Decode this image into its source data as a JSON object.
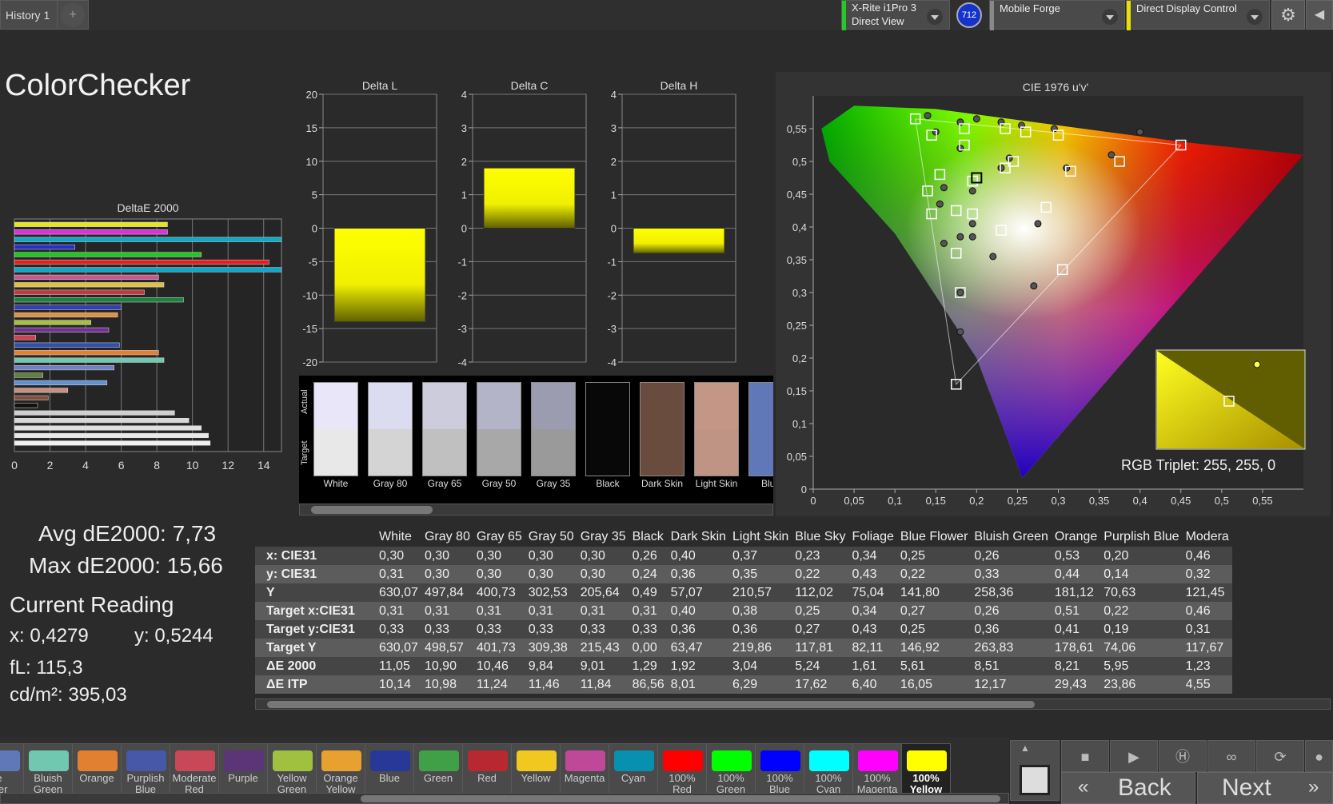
{
  "topbar": {
    "tab_label": "History 1",
    "tab_add": "+",
    "meter_line1": "X-Rite i1Pro 3",
    "meter_line2": "Direct View",
    "meter_color": "#22cc22",
    "badge": "712",
    "badge_color": "#1533c8",
    "pattern_source": "Mobile Forge",
    "pattern_color": "#888888",
    "display_control": "Direct Display Control",
    "display_color": "#e8e000",
    "settings_icon": "gear-icon"
  },
  "page_title": "ColorChecker",
  "deltae_chart": {
    "title": "DeltaE 2000",
    "ticks": [
      "0",
      "2",
      "4",
      "6",
      "8",
      "10",
      "12",
      "14"
    ],
    "xlim": [
      0,
      15
    ],
    "bars": [
      {
        "color": "#e5e520",
        "value": 8.6
      },
      {
        "color": "#dd30dd",
        "value": 8.6
      },
      {
        "color": "#10a8c8",
        "value": 15.0
      },
      {
        "color": "#2030c8",
        "value": 3.4
      },
      {
        "color": "#20c820",
        "value": 10.5
      },
      {
        "color": "#e02020",
        "value": 14.3
      },
      {
        "color": "#10a8c8",
        "value": 15.0
      },
      {
        "color": "#c85890",
        "value": 8.1
      },
      {
        "color": "#e0c040",
        "value": 8.4
      },
      {
        "color": "#c03840",
        "value": 7.3
      },
      {
        "color": "#208040",
        "value": 9.5
      },
      {
        "color": "#3040b0",
        "value": 6.0
      },
      {
        "color": "#e09040",
        "value": 5.8
      },
      {
        "color": "#a8c040",
        "value": 4.3
      },
      {
        "color": "#703090",
        "value": 5.3
      },
      {
        "color": "#d04050",
        "value": 1.2
      },
      {
        "color": "#3050b0",
        "value": 5.9
      },
      {
        "color": "#e08030",
        "value": 8.1
      },
      {
        "color": "#70c8b0",
        "value": 8.4
      },
      {
        "color": "#7080c0",
        "value": 5.6
      },
      {
        "color": "#608040",
        "value": 1.6
      },
      {
        "color": "#6090d0",
        "value": 5.2
      },
      {
        "color": "#c89080",
        "value": 3.0
      },
      {
        "color": "#805040",
        "value": 1.9
      },
      {
        "color": "#101010",
        "value": 1.3
      },
      {
        "color": "#d0d0d0",
        "value": 9.0
      },
      {
        "color": "#d8d8d8",
        "value": 9.8
      },
      {
        "color": "#e0e0e0",
        "value": 10.5
      },
      {
        "color": "#e8e8e8",
        "value": 10.9
      },
      {
        "color": "#f0f0f0",
        "value": 11.0
      }
    ]
  },
  "stats": {
    "avg": "Avg dE2000: 7,73",
    "max": "Max dE2000: 15,66",
    "current_reading": "Current Reading",
    "x": "x: 0,4279",
    "y": "y: 0,5244",
    "fl": "fL: 115,3",
    "cdm2": "cd/m²: 395,03"
  },
  "delta_charts": [
    {
      "title": "Delta L",
      "ticks": [
        "20",
        "15",
        "10",
        "5",
        "0",
        "-5",
        "-10",
        "-15",
        "-20"
      ],
      "ylim": [
        -20,
        20
      ],
      "value": -14
    },
    {
      "title": "Delta C",
      "ticks": [
        "4",
        "3",
        "2",
        "1",
        "0",
        "-1",
        "-2",
        "-3",
        "-4"
      ],
      "ylim": [
        -4,
        4
      ],
      "value": 1.8
    },
    {
      "title": "Delta H",
      "ticks": [
        "4",
        "3",
        "2",
        "1",
        "0",
        "-1",
        "-2",
        "-3",
        "-4"
      ],
      "ylim": [
        -4,
        4
      ],
      "value": -0.75
    }
  ],
  "swatches": {
    "actual_label": "Actual",
    "target_label": "Target",
    "items": [
      {
        "label": "White",
        "actual": "#e8e6f8",
        "target": "#e8e8e8"
      },
      {
        "label": "Gray 80",
        "actual": "#dcdcf0",
        "target": "#d4d4d4"
      },
      {
        "label": "Gray 65",
        "actual": "#ccccdc",
        "target": "#c0c0c0"
      },
      {
        "label": "Gray 50",
        "actual": "#b4b4c8",
        "target": "#a8a8a8"
      },
      {
        "label": "Gray 35",
        "actual": "#9c9cb0",
        "target": "#9a9a9a"
      },
      {
        "label": "Black",
        "actual": "#080808",
        "target": "#080808"
      },
      {
        "label": "Dark Skin",
        "actual": "#6a4c3e",
        "target": "#6a4c3e"
      },
      {
        "label": "Light Skin",
        "actual": "#c49686",
        "target": "#c09484"
      },
      {
        "label": "Blue",
        "actual": "#6078b8",
        "target": "#6078b8"
      }
    ]
  },
  "cie": {
    "title": "CIE 1976 u'v'",
    "x_ticks": [
      "0",
      "0,05",
      "0,1",
      "0,15",
      "0,2",
      "0,25",
      "0,3",
      "0,35",
      "0,4",
      "0,45",
      "0,5",
      "0,55"
    ],
    "y_ticks": [
      "0",
      "0,05",
      "0,1",
      "0,15",
      "0,2",
      "0,25",
      "0,3",
      "0,35",
      "0,4",
      "0,45",
      "0,5",
      "0,55"
    ],
    "xlim": [
      0,
      0.6
    ],
    "ylim": [
      0,
      0.6
    ],
    "targets": [
      [
        0.125,
        0.565
      ],
      [
        0.145,
        0.54
      ],
      [
        0.185,
        0.55
      ],
      [
        0.235,
        0.55
      ],
      [
        0.26,
        0.545
      ],
      [
        0.3,
        0.54
      ],
      [
        0.375,
        0.5
      ],
      [
        0.45,
        0.525
      ],
      [
        0.315,
        0.485
      ],
      [
        0.2,
        0.475
      ],
      [
        0.245,
        0.5
      ],
      [
        0.235,
        0.49
      ],
      [
        0.155,
        0.48
      ],
      [
        0.14,
        0.455
      ],
      [
        0.195,
        0.47
      ],
      [
        0.175,
        0.425
      ],
      [
        0.195,
        0.42
      ],
      [
        0.145,
        0.42
      ],
      [
        0.23,
        0.395
      ],
      [
        0.285,
        0.43
      ],
      [
        0.175,
        0.36
      ],
      [
        0.305,
        0.335
      ],
      [
        0.18,
        0.3
      ],
      [
        0.175,
        0.16
      ],
      [
        0.185,
        0.525
      ]
    ],
    "measured": [
      [
        0.14,
        0.57
      ],
      [
        0.15,
        0.545
      ],
      [
        0.18,
        0.56
      ],
      [
        0.2,
        0.565
      ],
      [
        0.23,
        0.56
      ],
      [
        0.255,
        0.555
      ],
      [
        0.295,
        0.55
      ],
      [
        0.4,
        0.545
      ],
      [
        0.365,
        0.51
      ],
      [
        0.24,
        0.505
      ],
      [
        0.23,
        0.49
      ],
      [
        0.31,
        0.49
      ],
      [
        0.18,
        0.52
      ],
      [
        0.16,
        0.46
      ],
      [
        0.155,
        0.435
      ],
      [
        0.195,
        0.455
      ],
      [
        0.195,
        0.405
      ],
      [
        0.18,
        0.385
      ],
      [
        0.195,
        0.385
      ],
      [
        0.16,
        0.375
      ],
      [
        0.22,
        0.355
      ],
      [
        0.275,
        0.405
      ],
      [
        0.18,
        0.3
      ],
      [
        0.18,
        0.24
      ],
      [
        0.27,
        0.31
      ]
    ],
    "current": [
      0.2,
      0.475
    ],
    "rgb_triplet": "RGB Triplet: 255, 255, 0"
  },
  "table": {
    "columns": [
      "White",
      "Gray 80",
      "Gray 65",
      "Gray 50",
      "Gray 35",
      "Black",
      "Dark Skin",
      "Light Skin",
      "Blue Sky",
      "Foliage",
      "Blue Flower",
      "Bluish Green",
      "Orange",
      "Purplish Blue",
      "Modera"
    ],
    "rows": [
      {
        "label": "x: CIE31",
        "values": [
          "0,30",
          "0,30",
          "0,30",
          "0,30",
          "0,30",
          "0,26",
          "0,40",
          "0,37",
          "0,23",
          "0,34",
          "0,25",
          "0,26",
          "0,53",
          "0,20",
          "0,46"
        ]
      },
      {
        "label": "y: CIE31",
        "values": [
          "0,31",
          "0,30",
          "0,30",
          "0,30",
          "0,30",
          "0,24",
          "0,36",
          "0,35",
          "0,22",
          "0,43",
          "0,22",
          "0,33",
          "0,44",
          "0,14",
          "0,32"
        ]
      },
      {
        "label": "Y",
        "values": [
          "630,07",
          "497,84",
          "400,73",
          "302,53",
          "205,64",
          "0,49",
          "57,07",
          "210,57",
          "112,02",
          "75,04",
          "141,80",
          "258,36",
          "181,12",
          "70,63",
          "121,45"
        ]
      },
      {
        "label": "Target x:CIE31",
        "values": [
          "0,31",
          "0,31",
          "0,31",
          "0,31",
          "0,31",
          "0,31",
          "0,40",
          "0,38",
          "0,25",
          "0,34",
          "0,27",
          "0,26",
          "0,51",
          "0,22",
          "0,46"
        ]
      },
      {
        "label": "Target y:CIE31",
        "values": [
          "0,33",
          "0,33",
          "0,33",
          "0,33",
          "0,33",
          "0,33",
          "0,36",
          "0,36",
          "0,27",
          "0,43",
          "0,25",
          "0,36",
          "0,41",
          "0,19",
          "0,31"
        ]
      },
      {
        "label": "Target Y",
        "values": [
          "630,07",
          "498,57",
          "401,73",
          "309,38",
          "215,43",
          "0,00",
          "63,47",
          "219,86",
          "117,81",
          "82,11",
          "146,92",
          "263,83",
          "178,61",
          "74,06",
          "117,67"
        ]
      },
      {
        "label": "ΔE 2000",
        "values": [
          "11,05",
          "10,90",
          "10,46",
          "9,84",
          "9,01",
          "1,29",
          "1,92",
          "3,04",
          "5,24",
          "1,61",
          "5,61",
          "8,51",
          "8,21",
          "5,95",
          "1,23"
        ]
      },
      {
        "label": "ΔE ITP",
        "values": [
          "10,14",
          "10,98",
          "11,24",
          "11,46",
          "11,84",
          "86,56",
          "8,01",
          "6,29",
          "17,62",
          "6,40",
          "16,05",
          "12,17",
          "29,43",
          "23,86",
          "4,55"
        ]
      }
    ]
  },
  "palette": [
    {
      "label": "e\nwer",
      "color": "#6078b8"
    },
    {
      "label": "Bluish\nGreen",
      "color": "#70c8b0"
    },
    {
      "label": "Orange",
      "color": "#e08030"
    },
    {
      "label": "Purplish\nBlue",
      "color": "#4858a8"
    },
    {
      "label": "Moderate\nRed",
      "color": "#c84858"
    },
    {
      "label": "Purple",
      "color": "#5c3478"
    },
    {
      "label": "Yellow\nGreen",
      "color": "#a0c040"
    },
    {
      "label": "Orange\nYellow",
      "color": "#e8a030"
    },
    {
      "label": "Blue",
      "color": "#283898"
    },
    {
      "label": "Green",
      "color": "#40a048"
    },
    {
      "label": "Red",
      "color": "#b82830"
    },
    {
      "label": "Yellow",
      "color": "#f0c820"
    },
    {
      "label": "Magenta",
      "color": "#c04898"
    },
    {
      "label": "Cyan",
      "color": "#0890b0"
    },
    {
      "label": "100% Red",
      "color": "#ff0000"
    },
    {
      "label": "100%\nGreen",
      "color": "#00ff00"
    },
    {
      "label": "100%\nBlue",
      "color": "#0000ff"
    },
    {
      "label": "100%\nCyan",
      "color": "#00ffff"
    },
    {
      "label": "100%\nMagenta",
      "color": "#ff00ff"
    },
    {
      "label": "100%\nYellow",
      "color": "#ffff00",
      "active": true
    }
  ],
  "controls": {
    "back": "Back",
    "next": "Next"
  }
}
